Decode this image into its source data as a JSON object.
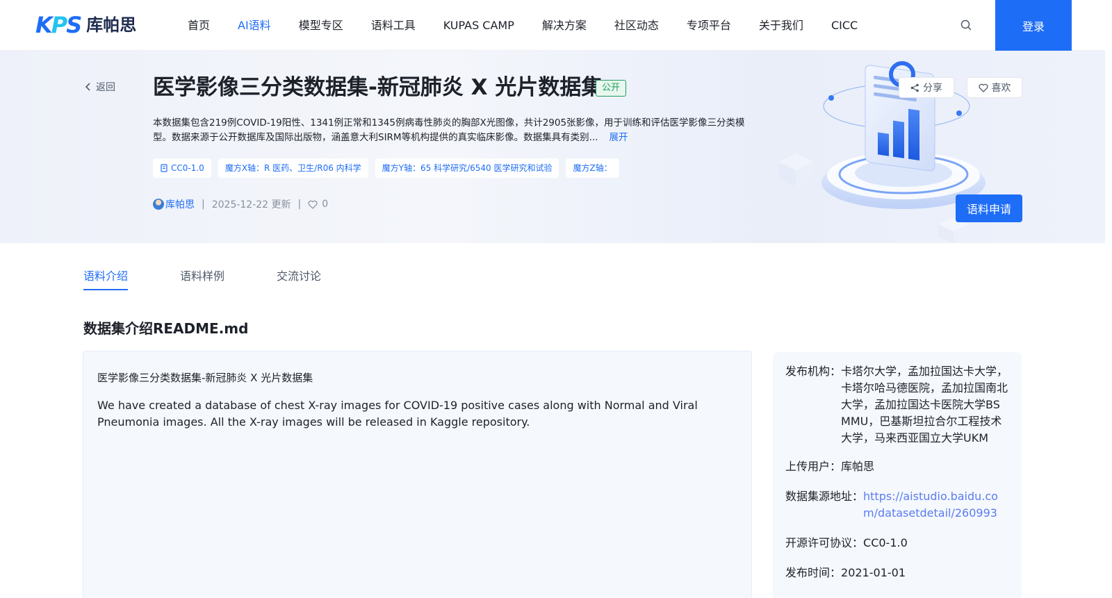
{
  "header": {
    "logo_mark": "KPS",
    "logo_text": "库帕思",
    "nav": [
      "首页",
      "AI语料",
      "模型专区",
      "语料工具",
      "KUPAS CAMP",
      "解决方案",
      "社区动态",
      "专项平台",
      "关于我们",
      "CICC"
    ],
    "active_nav": "AI语料",
    "login_label": "登录"
  },
  "hero": {
    "back_label": "返回",
    "title": "医学影像三分类数据集-新冠肺炎 X 光片数据集",
    "badge": "公开",
    "description": "本数据集包含219例COVID-19阳性、1341例正常和1345例病毒性肺炎的胸部X光图像，共计2905张影像，用于训练和评估医学影像三分类模型。数据来源于公开数据库及国际出版物，涵盖意大利SIRM等机构提供的真实临床影像。数据集具有类别...",
    "expand_label": "展开",
    "tags": [
      "CC0-1.0",
      "魔方X轴：R 医药、卫生/R06 内科学",
      "魔方Y轴：65 科学研究/6540 医学研究和试验",
      "魔方Z轴："
    ],
    "author": "库帕思",
    "separator": "|",
    "date": "2025-12-22 更新",
    "likes": "0",
    "share_label": "分享",
    "like_label": "喜欢",
    "apply_label": "语料申请"
  },
  "tabs": [
    "语料介绍",
    "语料样例",
    "交流讨论"
  ],
  "section_title": "数据集介绍README.md",
  "readme": {
    "heading": "医学影像三分类数据集-新冠肺炎 X 光片数据集",
    "body": "We have created a database of chest X-ray images for COVID-19 positive cases along with Normal and Viral Pneumonia images. All the X-ray images will be released in Kaggle repository."
  },
  "info": {
    "publisher_label": "发布机构：",
    "publisher": "卡塔尔大学，孟加拉国达卡大学，卡塔尔哈马德医院，孟加拉国南北大学，孟加拉国达卡医院大学BSMMU，巴基斯坦拉合尔工程技术大学，马来西亚国立大学UKM",
    "uploader_label": "上传用户：",
    "uploader": "库帕思",
    "source_label": "数据集源地址：",
    "source": "https://aistudio.baidu.com/datasetdetail/260993",
    "license_label": "开源许可协议：",
    "license": "CC0-1.0",
    "release_label": "发布时间：",
    "release": "2021-01-01"
  },
  "colors": {
    "accent": "#1e6df6",
    "public_badge": "#1e9e5c",
    "link": "#5b7cf0"
  },
  "icons": [
    "search-icon",
    "chevron-left-icon",
    "share-icon",
    "heart-icon",
    "license-icon"
  ]
}
